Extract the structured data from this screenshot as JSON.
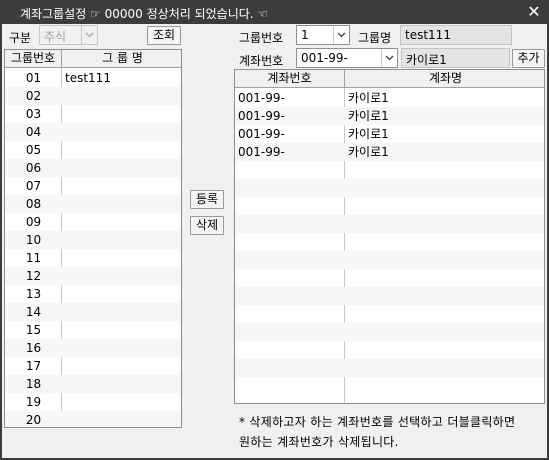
{
  "window": {
    "title": "계좌그룹설정 ☞ 00000 정상처리 되었습니다. ☜",
    "close_glyph": "✕"
  },
  "left": {
    "gubun_label": "구분",
    "gubun_value": "주식",
    "query_button": "조회",
    "columns": [
      "그룹번호",
      "그 룹 명"
    ],
    "rows": [
      {
        "no": "01",
        "name": "test111"
      },
      {
        "no": "02",
        "name": ""
      },
      {
        "no": "03",
        "name": ""
      },
      {
        "no": "04",
        "name": ""
      },
      {
        "no": "05",
        "name": ""
      },
      {
        "no": "06",
        "name": ""
      },
      {
        "no": "07",
        "name": ""
      },
      {
        "no": "08",
        "name": ""
      },
      {
        "no": "09",
        "name": ""
      },
      {
        "no": "10",
        "name": ""
      },
      {
        "no": "11",
        "name": ""
      },
      {
        "no": "12",
        "name": ""
      },
      {
        "no": "13",
        "name": ""
      },
      {
        "no": "14",
        "name": ""
      },
      {
        "no": "15",
        "name": ""
      },
      {
        "no": "16",
        "name": ""
      },
      {
        "no": "17",
        "name": ""
      },
      {
        "no": "18",
        "name": ""
      },
      {
        "no": "19",
        "name": ""
      },
      {
        "no": "20",
        "name": ""
      }
    ]
  },
  "middle": {
    "register_button": "등록",
    "delete_button": "삭제"
  },
  "right": {
    "group_no_label": "그룹번호",
    "group_no_value": "1",
    "group_name_label": "그룹명",
    "group_name_value": "test111",
    "account_label": "계좌번호",
    "account_value": "001-99-",
    "account_name_value": "카이로1",
    "add_button": "추가",
    "columns": [
      "계좌번호",
      "계좌명"
    ],
    "rows": [
      {
        "account": "001-99-",
        "name": "카이로1"
      },
      {
        "account": "001-99-",
        "name": "카이로1"
      },
      {
        "account": "001-99-",
        "name": "카이로1"
      },
      {
        "account": "001-99-",
        "name": "카이로1"
      }
    ],
    "empty_rows": 12,
    "note_line1": "* 삭제하고자 하는 계좌번호를 선택하고 더블클릭하면",
    "note_line2": "원하는 계좌번호가 삭제됩니다."
  }
}
